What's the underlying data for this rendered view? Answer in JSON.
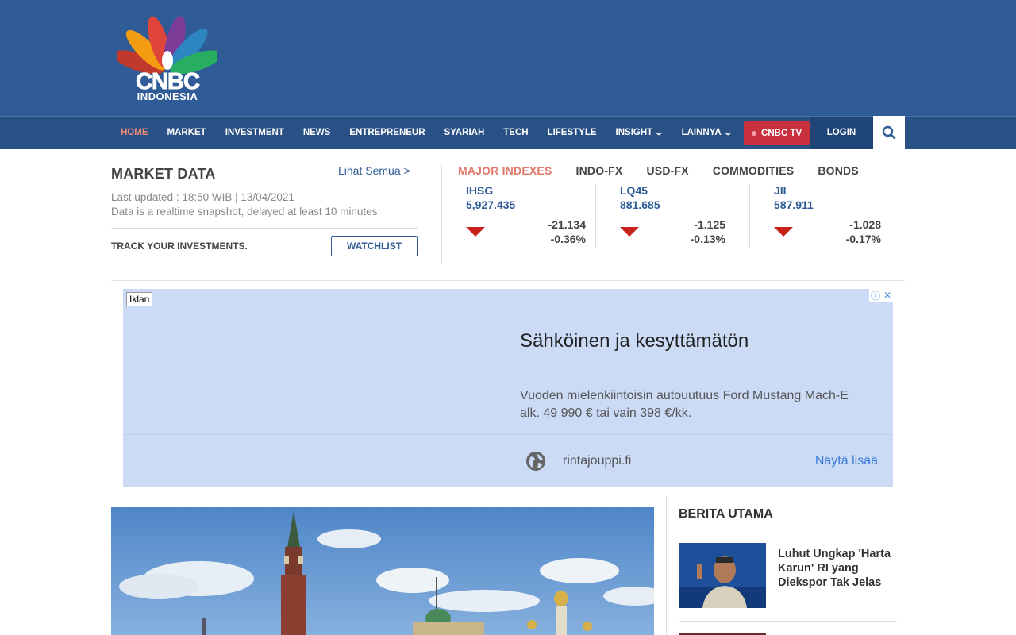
{
  "header": {
    "logo_text": "CNBC",
    "logo_sub": "INDONESIA"
  },
  "nav": {
    "items": [
      {
        "label": "HOME"
      },
      {
        "label": "MARKET"
      },
      {
        "label": "INVESTMENT"
      },
      {
        "label": "NEWS"
      },
      {
        "label": "ENTREPRENEUR"
      },
      {
        "label": "SYARIAH"
      },
      {
        "label": "TECH"
      },
      {
        "label": "LIFESTYLE"
      },
      {
        "label": "INSIGHT"
      },
      {
        "label": "LAINNYA"
      }
    ],
    "tv_label": "CNBC TV",
    "login_label": "LOGIN"
  },
  "market": {
    "title": "MARKET DATA",
    "see_all": "Lihat Semua >",
    "updated": "Last updated : 18:50 WIB | 13/04/2021",
    "note": "Data is a realtime snapshot, delayed at least 10 minutes",
    "track": "TRACK YOUR INVESTMENTS.",
    "watchlist": "WATCHLIST",
    "tabs": [
      "MAJOR INDEXES",
      "INDO-FX",
      "USD-FX",
      "COMMODITIES",
      "BONDS"
    ],
    "indexes": [
      {
        "name": "IHSG",
        "value": "5,927.435",
        "change": "-21.134",
        "percent": "-0.36%"
      },
      {
        "name": "LQ45",
        "value": "881.685",
        "change": "-1.125",
        "percent": "-0.13%"
      },
      {
        "name": "JII",
        "value": "587.911",
        "change": "-1.028",
        "percent": "-0.17%"
      }
    ]
  },
  "ad": {
    "tag": "Iklan",
    "headline": "Sähköinen ja kesyttämätön",
    "body": "Vuoden mielenkiintoisin autouutuus Ford Mustang Mach-E alk. 49 990 € tai vain 398 €/kk.",
    "domain": "rintajouppi.fi",
    "more": "Näytä lisää"
  },
  "berita": {
    "title": "BERITA UTAMA",
    "items": [
      {
        "headline": "Luhut Ungkap 'Harta Karun' RI yang Diekspor Tak Jelas"
      }
    ]
  },
  "colors": {
    "header_bg": "#2f5c96",
    "nav_bg": "#2a5185",
    "accent": "#e07a6b",
    "tv_red": "#c8303e",
    "down_red": "#c8201a",
    "ad_bg": "#cbdaf5"
  }
}
